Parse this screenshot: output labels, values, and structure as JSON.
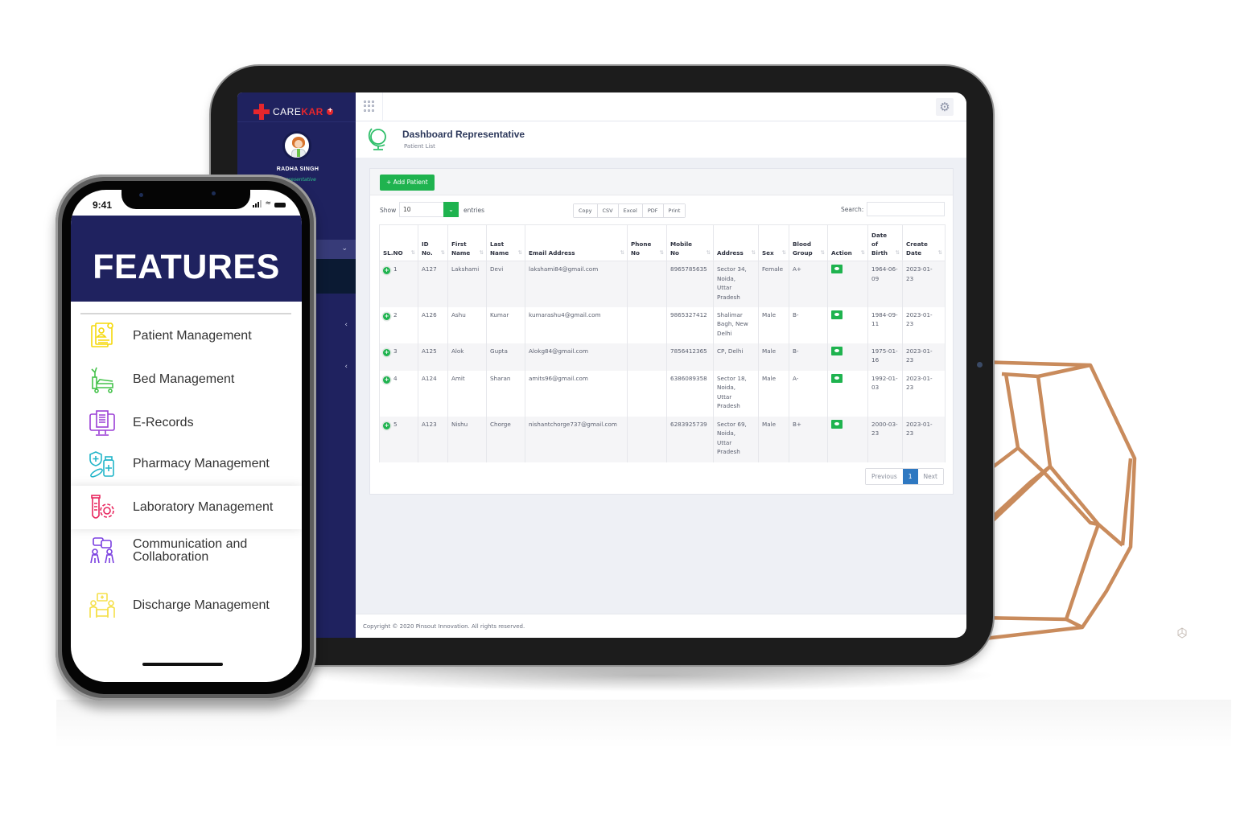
{
  "tablet": {
    "brand": {
      "part1": "CARE",
      "part2": "KAR"
    },
    "user": {
      "name": "RADHA SINGH",
      "role": "Representative"
    },
    "header": {
      "title": "Dashboard Representative",
      "subtitle": "Patient List"
    },
    "add_button": "+ Add Patient",
    "length_menu": {
      "show_label": "Show",
      "value": "10",
      "entries_label": "entries"
    },
    "export_buttons": [
      "Copy",
      "CSV",
      "Excel",
      "PDF",
      "Print"
    ],
    "search": {
      "label": "Search:",
      "value": ""
    },
    "table": {
      "columns": [
        [
          "SL.NO"
        ],
        [
          "ID",
          "No."
        ],
        [
          "First",
          "Name"
        ],
        [
          "Last",
          "Name"
        ],
        [
          "Email Address"
        ],
        [
          "Phone",
          "No"
        ],
        [
          "Mobile",
          "No"
        ],
        [
          "Address"
        ],
        [
          "Sex"
        ],
        [
          "Blood",
          "Group"
        ],
        [
          "Action"
        ],
        [
          "Date",
          "of",
          "Birth"
        ],
        [
          "Create",
          "Date"
        ]
      ],
      "rows": [
        {
          "sl": "1",
          "id": "A127",
          "first": "Lakshami",
          "last": "Devi",
          "email": "lakshami84@gmail.com",
          "phone": "",
          "mobile": "8965785635",
          "address": [
            "Sector 34,",
            "Noida,",
            "Uttar",
            "Pradesh"
          ],
          "sex": "Female",
          "blood": "A+",
          "dob": [
            "1964-06-",
            "09"
          ],
          "created": [
            "2023-01-",
            "23"
          ]
        },
        {
          "sl": "2",
          "id": "A126",
          "first": "Ashu",
          "last": "Kumar",
          "email": "kumarashu4@gmail.com",
          "phone": "",
          "mobile": "9865327412",
          "address": [
            "Shalimar",
            "Bagh, New",
            "Delhi"
          ],
          "sex": "Male",
          "blood": "B-",
          "dob": [
            "1984-09-",
            "11"
          ],
          "created": [
            "2023-01-",
            "23"
          ]
        },
        {
          "sl": "3",
          "id": "A125",
          "first": "Alok",
          "last": "Gupta",
          "email": "Alokg84@gmail.com",
          "phone": "",
          "mobile": "7856412365",
          "address": [
            "CP, Delhi"
          ],
          "sex": "Male",
          "blood": "B-",
          "dob": [
            "1975-01-",
            "16"
          ],
          "created": [
            "2023-01-",
            "23"
          ]
        },
        {
          "sl": "4",
          "id": "A124",
          "first": "Amit",
          "last": "Sharan",
          "email": "amits96@gmail.com",
          "phone": "",
          "mobile": "6386089358",
          "address": [
            "Sector 18,",
            "Noida,",
            "Uttar",
            "Pradesh"
          ],
          "sex": "Male",
          "blood": "A-",
          "dob": [
            "1992-01-",
            "03"
          ],
          "created": [
            "2023-01-",
            "23"
          ]
        },
        {
          "sl": "5",
          "id": "A123",
          "first": "Nishu",
          "last": "Chorge",
          "email": "nishantchorge737@gmail.com",
          "phone": "",
          "mobile": "6283925739",
          "address": [
            "Sector 69,",
            "Noida,",
            "Uttar",
            "Pradesh"
          ],
          "sex": "Male",
          "blood": "B+",
          "dob": [
            "2000-03-",
            "23"
          ],
          "created": [
            "2023-01-",
            "23"
          ]
        }
      ]
    },
    "pagination": {
      "previous": "Previous",
      "current": "1",
      "next": "Next"
    },
    "footer": "Copyright © 2020 Pinsout Innovation. All rights reserved.",
    "colors": {
      "sidebar": "#1f225f",
      "accent_green": "#1fb34f",
      "brand_red": "#e5262c",
      "page_active": "#2e78c1"
    }
  },
  "phone": {
    "status_time": "9:41",
    "banner_title": "FEATURES",
    "features": [
      {
        "label": "Patient Management",
        "icon": "patient-file-icon",
        "color": "#f5d90a"
      },
      {
        "label": "Bed Management",
        "icon": "hospital-bed-icon",
        "color": "#44c24a"
      },
      {
        "label": "E-Records",
        "icon": "monitor-document-icon",
        "color": "#9b3fd6"
      },
      {
        "label": "Pharmacy Management",
        "icon": "pharmacy-icon",
        "color": "#22b5c9"
      },
      {
        "label": "Laboratory Management",
        "icon": "test-tube-gear-icon",
        "color": "#e8265e"
      },
      {
        "label": [
          "Communication and",
          "Collaboration"
        ],
        "icon": "people-chat-icon",
        "color": "#7a3fe0"
      },
      {
        "label": "Discharge Management",
        "icon": "discharge-icon",
        "color": "#f5e04a"
      }
    ]
  }
}
